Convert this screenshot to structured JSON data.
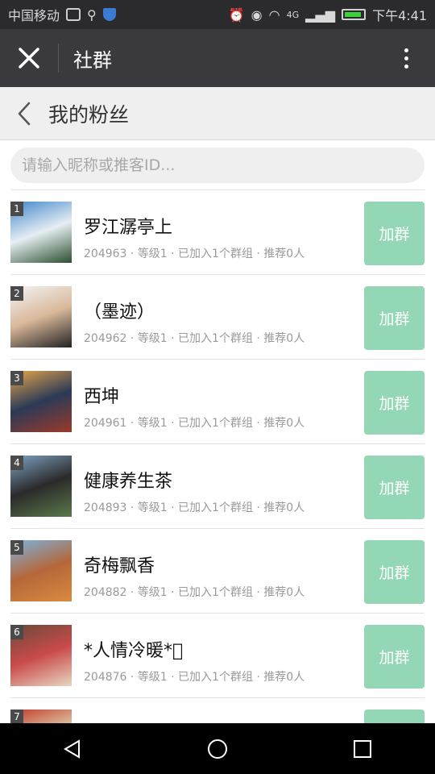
{
  "statusbar": {
    "carrier": "中国移动",
    "network": "4G",
    "time": "下午4:41"
  },
  "titlebar": {
    "title": "社群",
    "close_icon": "close-icon",
    "more_icon": "more-vertical-icon"
  },
  "header": {
    "title": "我的粉丝",
    "back_icon": "chevron-left-icon"
  },
  "search": {
    "placeholder": "请输入昵称或推客ID..."
  },
  "fans": [
    {
      "rank": "1",
      "name": "罗江潺亭上",
      "meta": "204963 · 等级1 · 已加入1个群组 · 推荐0人",
      "button": "加群",
      "avatar_colors": [
        "#3f87c9",
        "#e6eef3",
        "#2b4f2e"
      ]
    },
    {
      "rank": "2",
      "name": "（墨迹）",
      "meta": "204962 · 等级1 · 已加入1个群组 · 推荐0人",
      "button": "加群",
      "avatar_colors": [
        "#f4f4f4",
        "#d9b89a",
        "#222"
      ]
    },
    {
      "rank": "3",
      "name": "西坤",
      "meta": "204961 · 等级1 · 已加入1个群组 · 推荐0人",
      "button": "加群",
      "avatar_colors": [
        "#e7a64a",
        "#2b3a57",
        "#9b3a2a"
      ]
    },
    {
      "rank": "4",
      "name": "健康养生茶",
      "meta": "204893 · 等级1 · 已加入1个群组 · 推荐0人",
      "button": "加群",
      "avatar_colors": [
        "#7fa3c4",
        "#2a2a2a",
        "#5a7a4a"
      ]
    },
    {
      "rank": "5",
      "name": "奇梅飘香",
      "meta": "204882 · 等级1 · 已加入1个群组 · 推荐0人",
      "button": "加群",
      "avatar_colors": [
        "#7bb3e0",
        "#b5673a",
        "#d98b3f"
      ]
    },
    {
      "rank": "6",
      "name": "*人情冷暖*\u0000",
      "meta": "204876 · 等级1 · 已加入1个群组 · 推荐0人",
      "button": "加群",
      "avatar_colors": [
        "#6a4a3a",
        "#c94a4a",
        "#e8d7c2"
      ]
    },
    {
      "rank": "7",
      "name": "",
      "meta": "",
      "button": "",
      "avatar_colors": [
        "#c23b2a",
        "#e0d3b0",
        "#7a2a1a"
      ]
    }
  ],
  "navbar": {
    "back_icon": "triangle-back-icon",
    "home_icon": "circle-home-icon",
    "recents_icon": "square-recents-icon"
  },
  "colors": {
    "accent_button": "#94d7b6",
    "titlebar": "#3a3a3e",
    "statusbar": "#2b2b2e"
  }
}
